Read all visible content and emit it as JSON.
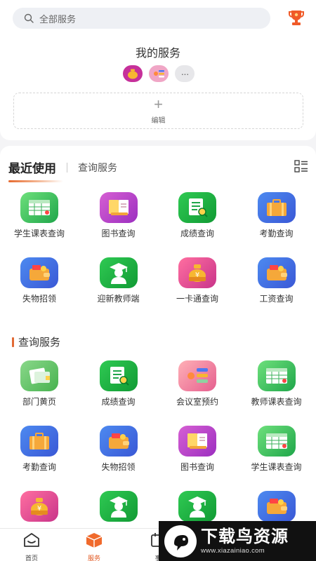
{
  "search": {
    "placeholder": "全部服务"
  },
  "my_services": {
    "title": "我的服务",
    "more_label": "···",
    "edit_plus": "+",
    "edit_label": "编辑"
  },
  "tabs": {
    "recent": "最近使用",
    "query": "查询服务"
  },
  "recent_apps": [
    {
      "label": "学生课表查询",
      "icon": "spreadsheet-icon",
      "color": "green"
    },
    {
      "label": "图书查询",
      "icon": "book-icon",
      "color": "purple"
    },
    {
      "label": "成绩查询",
      "icon": "report-search-icon",
      "color": "dgreen"
    },
    {
      "label": "考勤查询",
      "icon": "briefcase-icon",
      "color": "blue"
    },
    {
      "label": "失物招领",
      "icon": "wallet-icon",
      "color": "blue"
    },
    {
      "label": "迎新教师端",
      "icon": "graduate-icon",
      "color": "dgreen"
    },
    {
      "label": "一卡通查询",
      "icon": "money-bag-icon",
      "color": "pink"
    },
    {
      "label": "工资查询",
      "icon": "wallet-icon",
      "color": "blue"
    }
  ],
  "query_section": {
    "title": "查询服务"
  },
  "query_apps": [
    {
      "label": "部门黄页",
      "icon": "phonebook-icon",
      "color": "lgreen"
    },
    {
      "label": "成绩查询",
      "icon": "report-search-icon",
      "color": "dgreen"
    },
    {
      "label": "会议室预约",
      "icon": "meeting-room-icon",
      "color": "peach"
    },
    {
      "label": "教师课表查询",
      "icon": "spreadsheet-icon",
      "color": "green"
    },
    {
      "label": "考勤查询",
      "icon": "briefcase-icon",
      "color": "blue"
    },
    {
      "label": "失物招领",
      "icon": "wallet-icon",
      "color": "blue"
    },
    {
      "label": "图书查询",
      "icon": "book-icon",
      "color": "purple"
    },
    {
      "label": "学生课表查询",
      "icon": "spreadsheet-icon",
      "color": "green"
    },
    {
      "label": "",
      "icon": "money-bag-icon",
      "color": "pink"
    },
    {
      "label": "",
      "icon": "graduate-icon",
      "color": "dgreen"
    },
    {
      "label": "",
      "icon": "graduate-icon",
      "color": "dgreen"
    },
    {
      "label": "",
      "icon": "wallet-icon",
      "color": "blue"
    }
  ],
  "bottom_nav": [
    {
      "label": "首页",
      "icon": "home-icon",
      "active": false
    },
    {
      "label": "服务",
      "icon": "cube-icon",
      "active": true
    },
    {
      "label": "事",
      "icon": "calendar-icon",
      "active": false
    }
  ],
  "watermark": {
    "title": "下载鸟资源",
    "url": "www.xiazainiao.com"
  },
  "colors": {
    "accent": "#e25a24",
    "background": "#f4f4f6"
  }
}
